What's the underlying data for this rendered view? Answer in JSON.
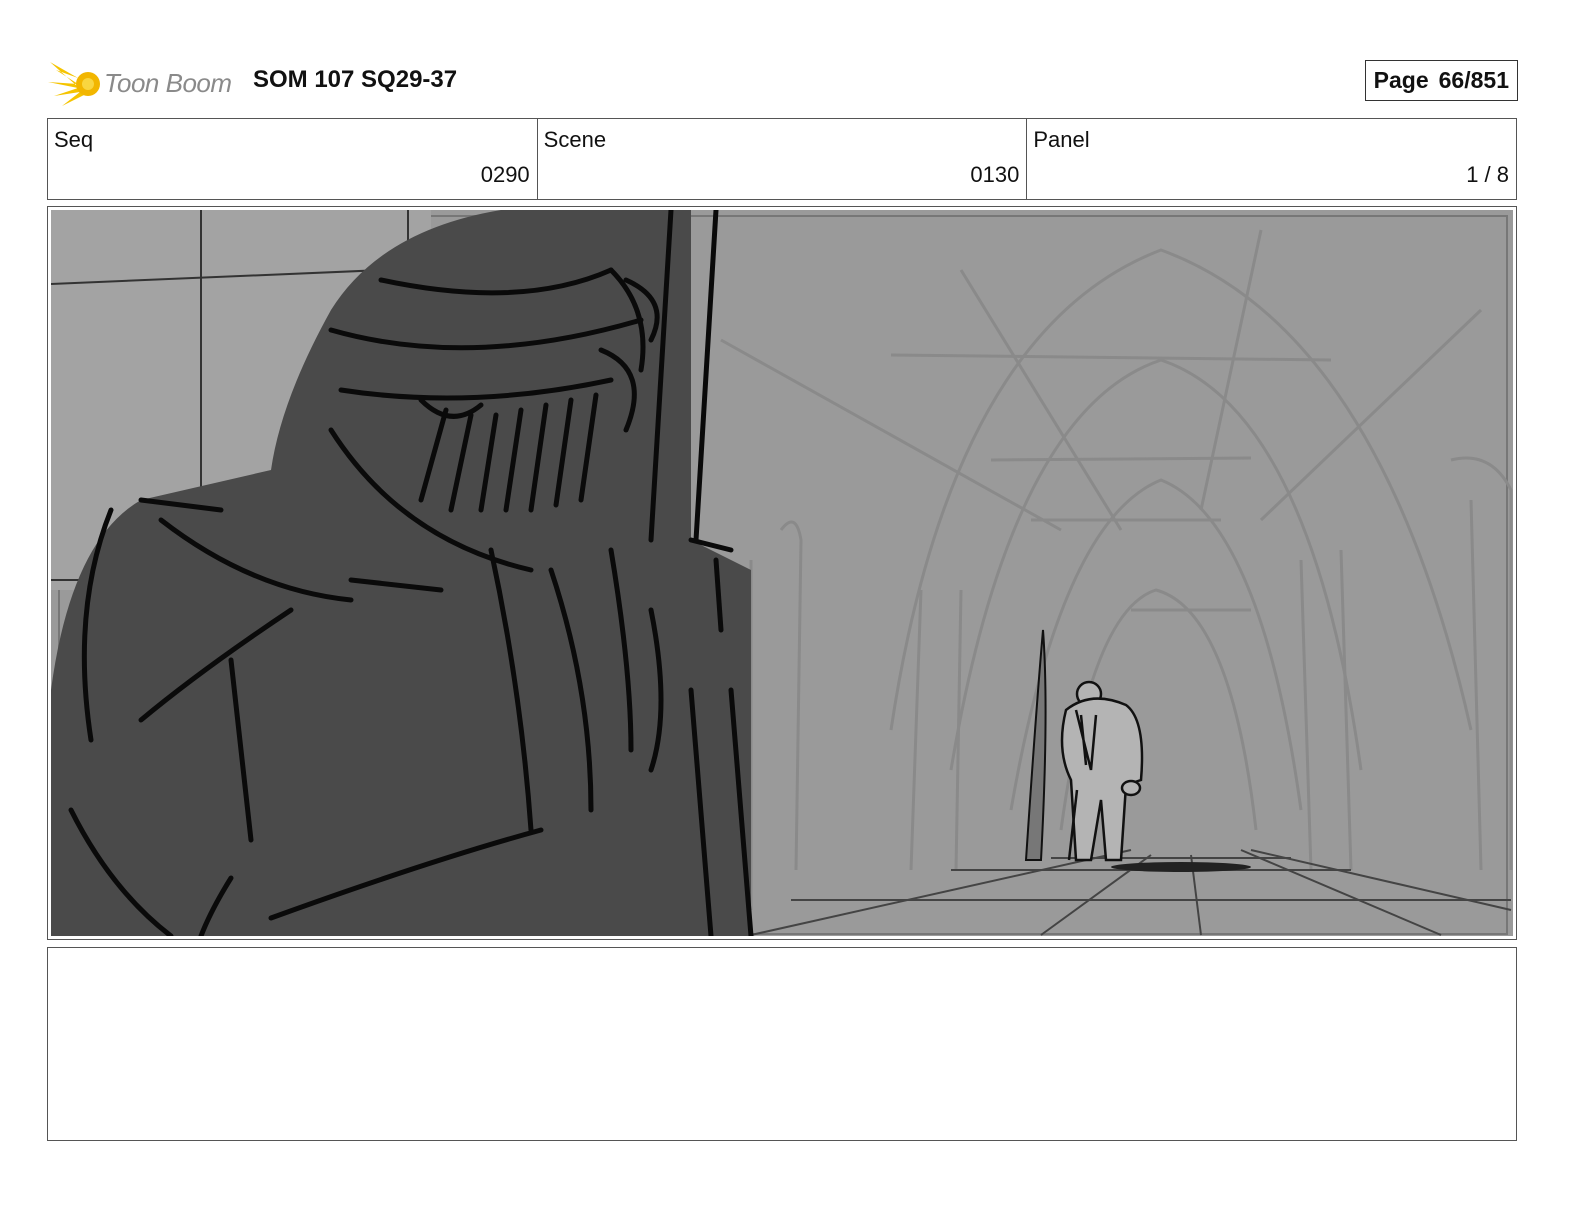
{
  "header": {
    "logo_text": "Toon Boom",
    "title": "SOM 107 SQ29-37",
    "page_label": "Page",
    "page_value": "66/851"
  },
  "info": {
    "seq_label": "Seq",
    "seq_value": "0290",
    "scene_label": "Scene",
    "scene_value": "0130",
    "panel_label": "Panel",
    "panel_value": "1 / 8"
  },
  "icons": {
    "logo": "toon-boom-star-logo-icon"
  },
  "colors": {
    "logo_accent": "#f5c400",
    "sketch_bg": "#9a9a9a",
    "foreground_figure": "#4a4a4a"
  }
}
